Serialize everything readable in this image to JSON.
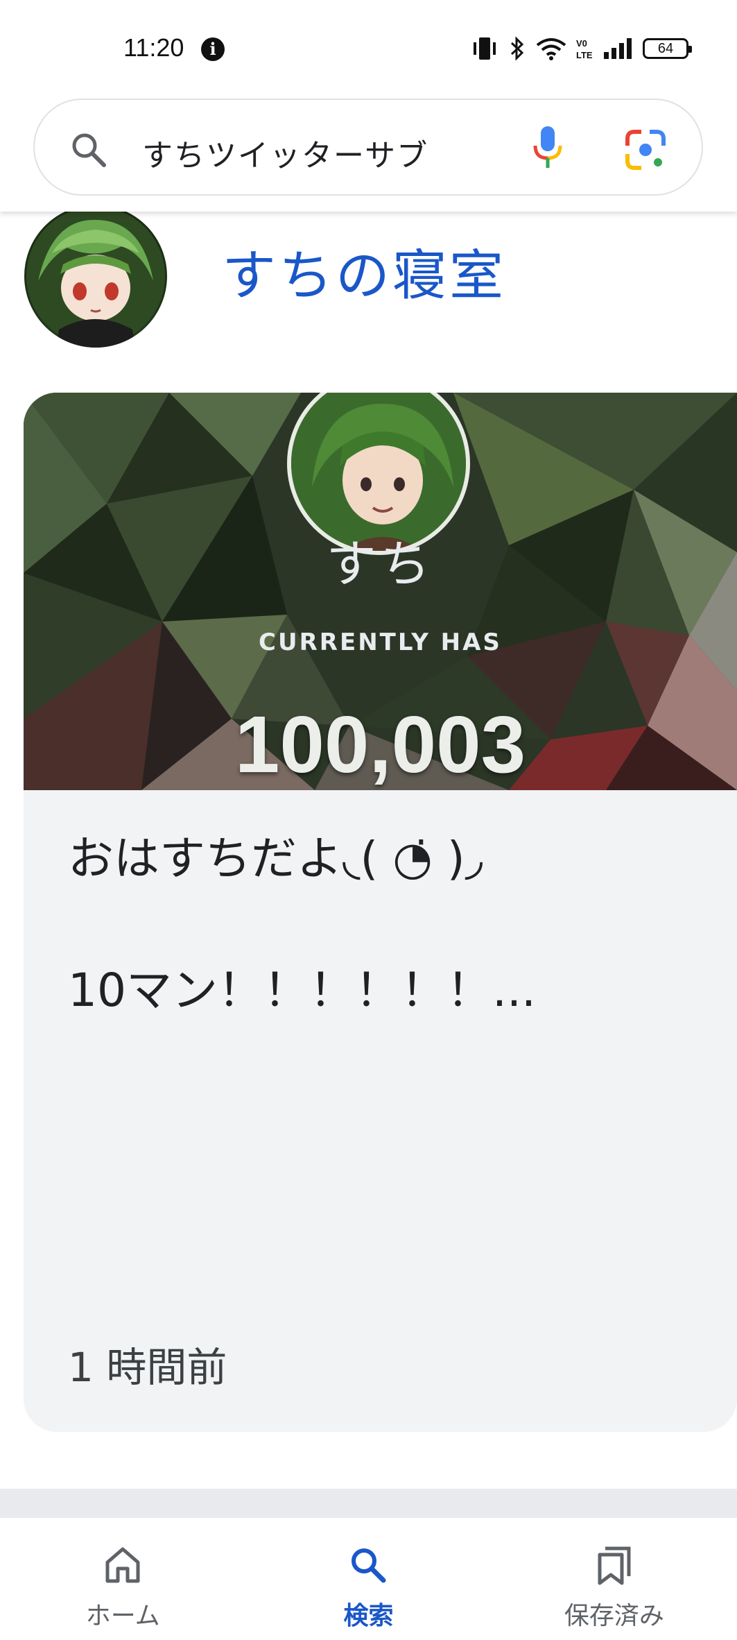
{
  "status_bar": {
    "time": "11:20",
    "battery": "64"
  },
  "search": {
    "query": "すちツイッターサブ"
  },
  "result": {
    "title": "すちの寝室"
  },
  "card": {
    "image_name": "すち",
    "image_has": "CURRENTLY HAS",
    "image_count": "100,003",
    "line1": "おはすちだよ◟( ◔̇ )◞",
    "line2": "10マン！！！！！！...",
    "time": "1 時間前"
  },
  "bottom_nav": {
    "home_label": "ホーム",
    "search_label": "検索",
    "saved_label": "保存済み"
  },
  "colors": {
    "accent": "#1a57c8",
    "card_bg": "#f1f3f4"
  }
}
